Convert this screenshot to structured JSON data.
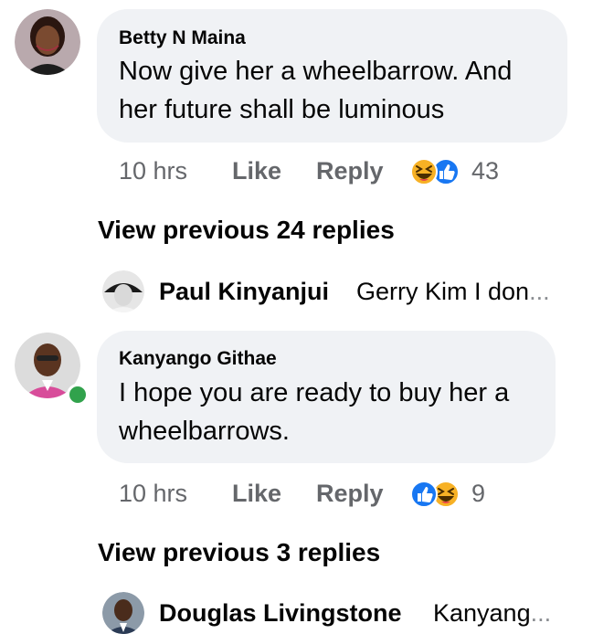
{
  "comments": [
    {
      "author": "Betty N Maina",
      "text_line1": "Now give her a wheelbarrow. And",
      "text_line2": "her future shall be luminous",
      "time": "10 hrs",
      "like_label": "Like",
      "reply_label": "Reply",
      "reaction_icons": [
        "haha-reaction-icon",
        "like-reaction-icon"
      ],
      "reaction_count": "43",
      "view_previous": "View previous 24 replies",
      "latest_reply": {
        "name": "Paul Kinyanjui",
        "snippet": "Gerry Kim I don",
        "ellipsis": "..."
      }
    },
    {
      "author": "Kanyango Githae",
      "text_line1": "I hope you are ready to buy her a",
      "text_line2": "wheelbarrows.",
      "time": "10 hrs",
      "like_label": "Like",
      "reply_label": "Reply",
      "reaction_icons": [
        "like-reaction-icon",
        "haha-reaction-icon"
      ],
      "reaction_count": "9",
      "online": true,
      "view_previous": "View previous 3 replies",
      "latest_reply": {
        "name": "Douglas Livingstone",
        "snippet": "Kanyang",
        "ellipsis": "..."
      }
    }
  ],
  "colors": {
    "bubble": "#f0f2f5",
    "meta_text": "#65676b",
    "like_blue": "#1877f2",
    "haha_yellow": "#f7b125",
    "online_green": "#31a24c"
  }
}
